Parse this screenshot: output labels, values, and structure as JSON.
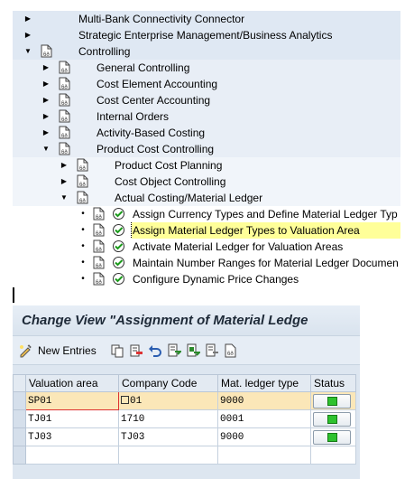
{
  "tree": {
    "items": [
      {
        "label": "Multi-Bank Connectivity Connector"
      },
      {
        "label": "Strategic Enterprise Management/Business Analytics"
      },
      {
        "label": "Controlling"
      },
      {
        "label": "General Controlling"
      },
      {
        "label": "Cost Element Accounting"
      },
      {
        "label": "Cost Center Accounting"
      },
      {
        "label": "Internal Orders"
      },
      {
        "label": "Activity-Based Costing"
      },
      {
        "label": "Product Cost Controlling"
      },
      {
        "label": "Product Cost Planning"
      },
      {
        "label": "Cost Object Controlling"
      },
      {
        "label": "Actual Costing/Material Ledger"
      },
      {
        "label": "Assign Currency Types and Define Material Ledger Typ"
      },
      {
        "label": "Assign Material Ledger Types to Valuation Area"
      },
      {
        "label": "Activate Material Ledger for Valuation Areas"
      },
      {
        "label": "Maintain Number Ranges for Material Ledger Documen"
      },
      {
        "label": "Configure Dynamic Price Changes"
      }
    ]
  },
  "view": {
    "title": "Change View \"Assignment of Material Ledge",
    "toolbar": {
      "new_entries_label": "New Entries",
      "icons": [
        "copy-icon",
        "delete-icon",
        "undo-icon",
        "select-all-icon",
        "select-block-icon",
        "deselect-all-icon",
        "print-icon"
      ]
    },
    "table": {
      "headers": [
        "Valuation area",
        "Company Code",
        "Mat. ledger type",
        "Status"
      ],
      "rows": [
        {
          "valuation_area": "SP01",
          "company_code": "01",
          "ledger_type": "9000",
          "status": "green"
        },
        {
          "valuation_area": "TJ01",
          "company_code": "1710",
          "ledger_type": "0001",
          "status": "green"
        },
        {
          "valuation_area": "TJ03",
          "company_code": "TJ03",
          "ledger_type": "9000",
          "status": "green"
        }
      ]
    }
  },
  "colors": {
    "selected_row": "#fbe7b8",
    "selected_item": "#ffff99",
    "status_ok": "#2ec22e"
  }
}
